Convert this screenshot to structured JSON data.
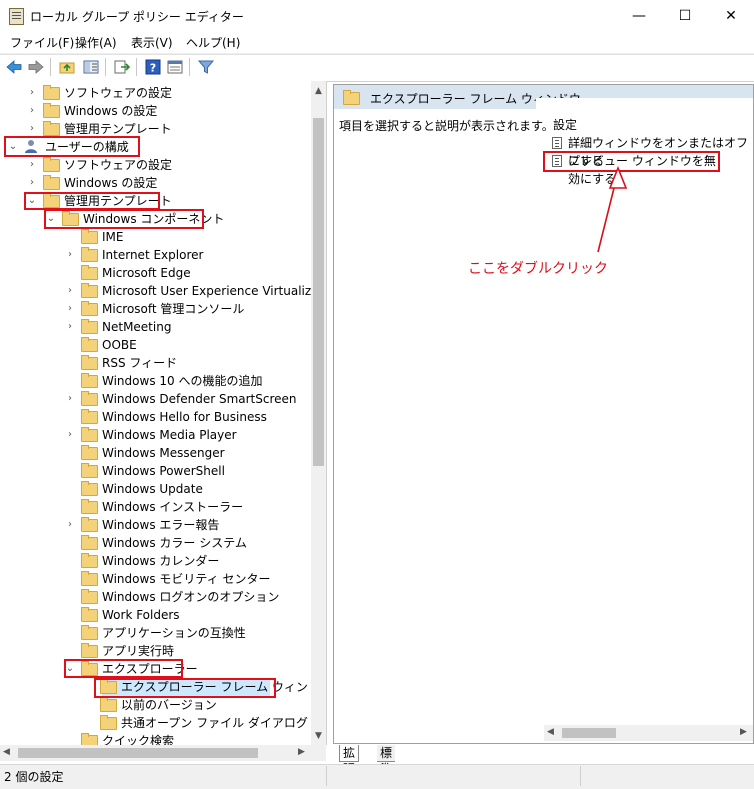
{
  "window": {
    "title": "ローカル グループ ポリシー エディター",
    "minimize_glyph": "—",
    "maximize_glyph": "☐",
    "close_glyph": "✕"
  },
  "menu": {
    "items": [
      "ファイル(F)",
      "操作(A)",
      "表示(V)",
      "ヘルプ(H)"
    ]
  },
  "toolbar": {
    "buttons": [
      "back-icon",
      "forward-icon",
      "up-folder-icon",
      "show-hide-tree-icon",
      "export-list-icon",
      "help-icon",
      "properties-icon",
      "filter-icon"
    ]
  },
  "tree": {
    "rows": [
      {
        "label": "ソフトウェアの設定",
        "chevron": "›",
        "type": "folder"
      },
      {
        "label": "Windows の設定",
        "chevron": "›",
        "type": "folder"
      },
      {
        "label": "管理用テンプレート",
        "chevron": "›",
        "type": "folder"
      },
      {
        "label": "ユーザーの構成",
        "chevron": "⌄",
        "type": "user"
      },
      {
        "label": "ソフトウェアの設定",
        "chevron": "›",
        "type": "folder"
      },
      {
        "label": "Windows の設定",
        "chevron": "›",
        "type": "folder"
      },
      {
        "label": "管理用テンプレート",
        "chevron": "⌄",
        "type": "folder"
      },
      {
        "label": "Windows コンポーネント",
        "chevron": "⌄",
        "type": "folder"
      },
      {
        "label": "IME",
        "chevron": "",
        "type": "folder"
      },
      {
        "label": "Internet Explorer",
        "chevron": "›",
        "type": "folder"
      },
      {
        "label": "Microsoft Edge",
        "chevron": "",
        "type": "folder"
      },
      {
        "label": "Microsoft User Experience Virtualization",
        "chevron": "›",
        "type": "folder"
      },
      {
        "label": "Microsoft 管理コンソール",
        "chevron": "›",
        "type": "folder"
      },
      {
        "label": "NetMeeting",
        "chevron": "›",
        "type": "folder"
      },
      {
        "label": "OOBE",
        "chevron": "",
        "type": "folder"
      },
      {
        "label": "RSS フィード",
        "chevron": "",
        "type": "folder"
      },
      {
        "label": "Windows 10 への機能の追加",
        "chevron": "",
        "type": "folder"
      },
      {
        "label": "Windows Defender SmartScreen",
        "chevron": "›",
        "type": "folder"
      },
      {
        "label": "Windows Hello for Business",
        "chevron": "",
        "type": "folder"
      },
      {
        "label": "Windows Media Player",
        "chevron": "›",
        "type": "folder"
      },
      {
        "label": "Windows Messenger",
        "chevron": "",
        "type": "folder"
      },
      {
        "label": "Windows PowerShell",
        "chevron": "",
        "type": "folder"
      },
      {
        "label": "Windows Update",
        "chevron": "",
        "type": "folder"
      },
      {
        "label": "Windows インストーラー",
        "chevron": "",
        "type": "folder"
      },
      {
        "label": "Windows エラー報告",
        "chevron": "›",
        "type": "folder"
      },
      {
        "label": "Windows カラー システム",
        "chevron": "",
        "type": "folder"
      },
      {
        "label": "Windows カレンダー",
        "chevron": "",
        "type": "folder"
      },
      {
        "label": "Windows モビリティ センター",
        "chevron": "",
        "type": "folder"
      },
      {
        "label": "Windows ログオンのオプション",
        "chevron": "",
        "type": "folder"
      },
      {
        "label": "Work Folders",
        "chevron": "",
        "type": "folder"
      },
      {
        "label": "アプリケーションの互換性",
        "chevron": "",
        "type": "folder"
      },
      {
        "label": "アプリ実行時",
        "chevron": "",
        "type": "folder"
      },
      {
        "label": "エクスプローラー",
        "chevron": "⌄",
        "type": "folder"
      },
      {
        "label": "エクスプローラー フレーム ウィンドウ",
        "chevron": "",
        "type": "folder"
      },
      {
        "label": "以前のバージョン",
        "chevron": "",
        "type": "folder"
      },
      {
        "label": "共通オープン ファイル ダイアログ",
        "chevron": "",
        "type": "folder"
      },
      {
        "label": "クイック検索",
        "chevron": "",
        "type": "folder"
      }
    ]
  },
  "detail": {
    "header": "エクスプローラー フレーム ウィンドウ",
    "description": "項目を選択すると説明が表示されます。",
    "column_header": "設定",
    "settings": [
      "詳細ウィンドウをオンまたはオフにする",
      "プレビュー ウィンドウを無効にする"
    ],
    "annotation": "ここをダブルクリック",
    "tabs": [
      "拡張",
      "標準"
    ]
  },
  "status": {
    "text": "2 個の設定"
  },
  "colors": {
    "highlight_red": "#e0101a",
    "selection_blue": "#cce8ff",
    "header_blue": "#d9e4f1",
    "folder_yellow": "#f3d27a"
  }
}
